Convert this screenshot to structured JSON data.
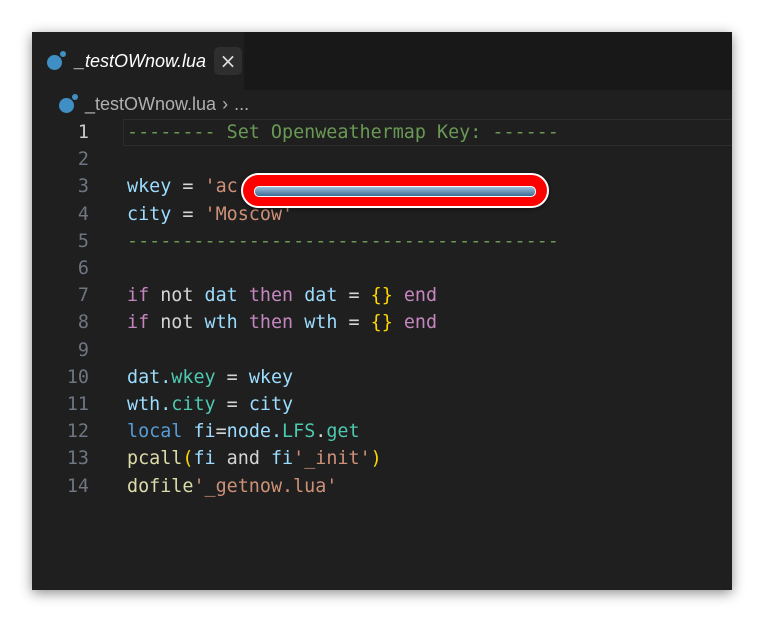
{
  "tab": {
    "title": "_testOWnow.lua",
    "close_icon": "×",
    "icon": "lua-file-icon"
  },
  "breadcrumb": {
    "file": "_testOWnow.lua",
    "separator": "›",
    "more": "..."
  },
  "editor": {
    "current_line": 1,
    "lines": [
      {
        "n": "1",
        "tokens": [
          {
            "t": "-------- Set Openweathermap Key: ------",
            "c": "comment"
          }
        ]
      },
      {
        "n": "2",
        "tokens": []
      },
      {
        "n": "3",
        "tokens": [
          {
            "t": "wkey",
            "c": "var"
          },
          {
            "t": " = ",
            "c": "op"
          },
          {
            "t": "'ac                         25'",
            "c": "str"
          }
        ],
        "redacted": true
      },
      {
        "n": "4",
        "tokens": [
          {
            "t": "city",
            "c": "var"
          },
          {
            "t": " = ",
            "c": "op"
          },
          {
            "t": "'Moscow'",
            "c": "str"
          }
        ]
      },
      {
        "n": "5",
        "tokens": [
          {
            "t": "---------------------------------------",
            "c": "comment"
          }
        ]
      },
      {
        "n": "6",
        "tokens": []
      },
      {
        "n": "7",
        "tokens": [
          {
            "t": "if",
            "c": "kw"
          },
          {
            "t": " not ",
            "c": "op"
          },
          {
            "t": "dat",
            "c": "var"
          },
          {
            "t": " then ",
            "c": "kw"
          },
          {
            "t": "dat",
            "c": "var"
          },
          {
            "t": " = ",
            "c": "op"
          },
          {
            "t": "{}",
            "c": "brace"
          },
          {
            "t": " end",
            "c": "kw"
          }
        ]
      },
      {
        "n": "8",
        "tokens": [
          {
            "t": "if",
            "c": "kw"
          },
          {
            "t": " not ",
            "c": "op"
          },
          {
            "t": "wth",
            "c": "var"
          },
          {
            "t": " then ",
            "c": "kw"
          },
          {
            "t": "wth",
            "c": "var"
          },
          {
            "t": " = ",
            "c": "op"
          },
          {
            "t": "{}",
            "c": "brace"
          },
          {
            "t": " end",
            "c": "kw"
          }
        ]
      },
      {
        "n": "9",
        "tokens": []
      },
      {
        "n": "10",
        "tokens": [
          {
            "t": "dat.",
            "c": "var"
          },
          {
            "t": "wkey",
            "c": "field"
          },
          {
            "t": " = ",
            "c": "op"
          },
          {
            "t": "wkey",
            "c": "var"
          }
        ]
      },
      {
        "n": "11",
        "tokens": [
          {
            "t": "wth.",
            "c": "var"
          },
          {
            "t": "city",
            "c": "field"
          },
          {
            "t": " = ",
            "c": "op"
          },
          {
            "t": "city",
            "c": "var"
          }
        ]
      },
      {
        "n": "12",
        "tokens": [
          {
            "t": "local",
            "c": "local"
          },
          {
            "t": " fi",
            "c": "var"
          },
          {
            "t": "=",
            "c": "op"
          },
          {
            "t": "node.",
            "c": "var"
          },
          {
            "t": "LFS",
            "c": "field"
          },
          {
            "t": ".",
            "c": "op"
          },
          {
            "t": "get",
            "c": "field"
          }
        ]
      },
      {
        "n": "13",
        "tokens": [
          {
            "t": "pcall",
            "c": "fn"
          },
          {
            "t": "(",
            "c": "brace"
          },
          {
            "t": "fi",
            "c": "var"
          },
          {
            "t": " and ",
            "c": "op"
          },
          {
            "t": "fi",
            "c": "var"
          },
          {
            "t": "'_init'",
            "c": "str"
          },
          {
            "t": ")",
            "c": "brace"
          }
        ]
      },
      {
        "n": "14",
        "tokens": [
          {
            "t": "dofile",
            "c": "fn"
          },
          {
            "t": "'_getnow.lua'",
            "c": "str"
          }
        ]
      }
    ]
  },
  "colors": {
    "comment": "#6a9955",
    "var": "#9cdcfe",
    "string": "#ce9178",
    "keyword": "#c586c0",
    "brace": "#ffd700",
    "field": "#4ec9b0",
    "redaction": "#ff0000"
  }
}
